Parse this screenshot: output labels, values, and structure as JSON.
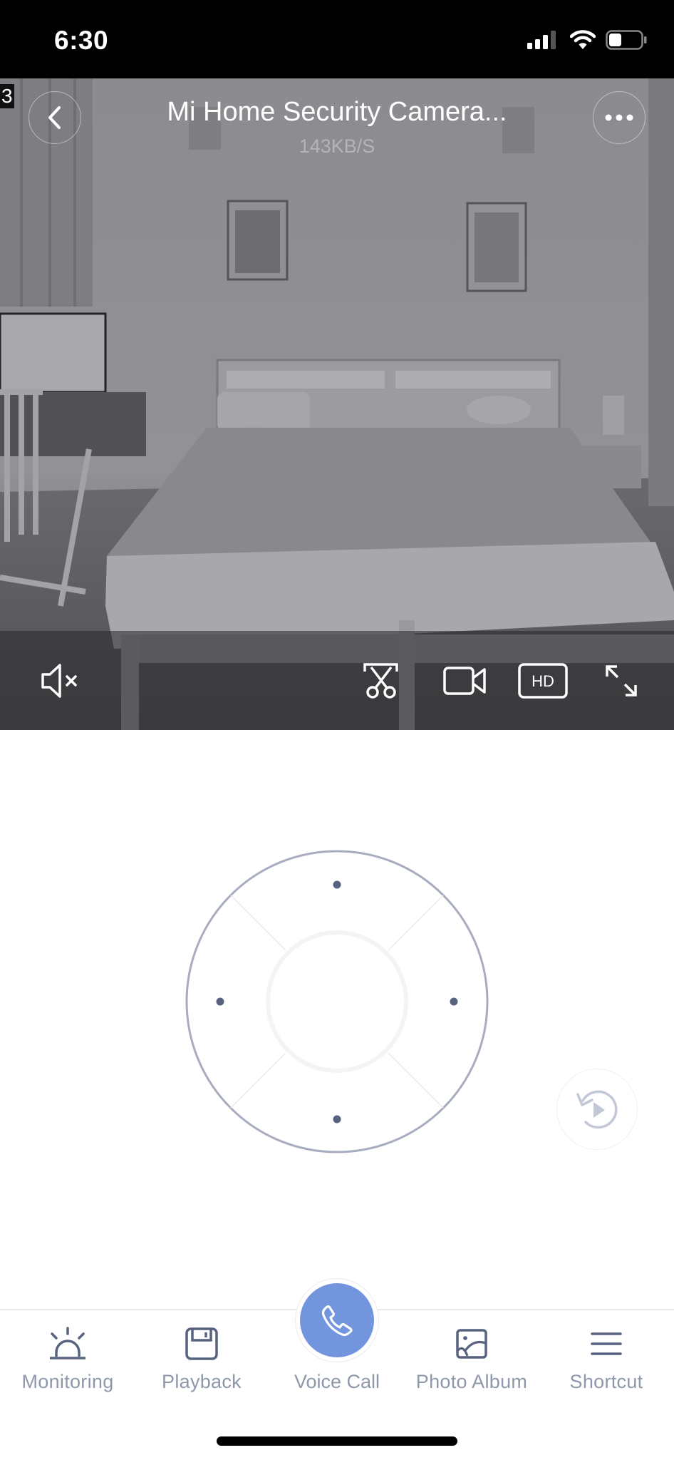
{
  "status_bar": {
    "time": "6:30",
    "icons": [
      "cellular-signal-icon",
      "wifi-icon",
      "battery-icon"
    ]
  },
  "camera": {
    "title": "Mi Home Security Camera...",
    "bitrate": "143KB/S",
    "osd_fragment": "3",
    "back_icon": "chevron-left-icon",
    "more_icon": "more-dots-icon",
    "controls": [
      {
        "name": "mute-toggle",
        "icon": "speaker-muted-icon",
        "state": "muted"
      },
      {
        "name": "screenshot",
        "icon": "scissors-clip-icon"
      },
      {
        "name": "record",
        "icon": "video-camera-icon"
      },
      {
        "name": "quality",
        "icon": "hd-badge-icon",
        "label": "HD"
      },
      {
        "name": "fullscreen",
        "icon": "expand-arrows-icon"
      }
    ]
  },
  "ptz": {
    "directions": [
      "up",
      "right",
      "down",
      "left"
    ],
    "colors": {
      "ring": "#a7adbf",
      "dot": "#57627e",
      "inner": "#f3f4f5"
    }
  },
  "replay": {
    "icon": "replay-play-icon"
  },
  "bottom_nav": {
    "items": [
      {
        "label": "Monitoring",
        "icon": "alarm-light-icon"
      },
      {
        "label": "Playback",
        "icon": "floppy-disk-icon"
      },
      {
        "label": "Voice Call",
        "icon": "phone-icon"
      },
      {
        "label": "Photo Album",
        "icon": "photo-icon"
      },
      {
        "label": "Shortcut",
        "icon": "menu-lines-icon"
      }
    ],
    "accent": "#7395de",
    "icon_color": "#57627e",
    "label_color": "#8f97ab"
  }
}
